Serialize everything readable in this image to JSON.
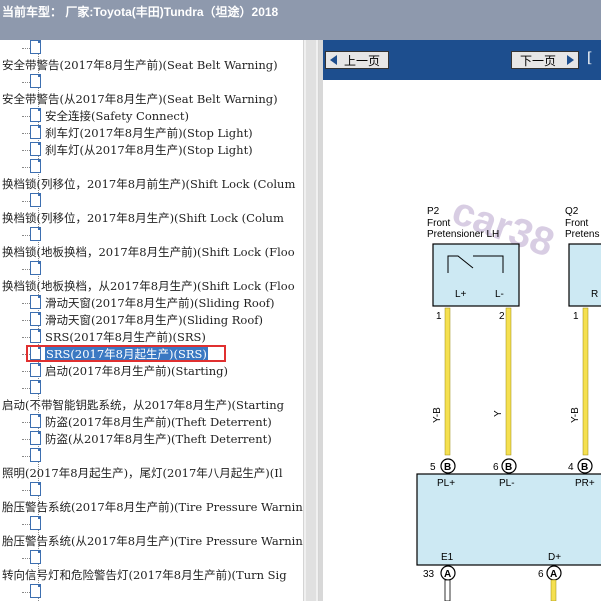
{
  "title": "当前车型： 厂家:Toyota(丰田)Tundra（坦途）2018",
  "tree": {
    "items": [
      {
        "label": "",
        "level": 1
      },
      {
        "label": "安全带警告(2017年8月生产前)(Seat Belt Warning)",
        "level": 0
      },
      {
        "label": "",
        "level": 1
      },
      {
        "label": "安全带警告(从2017年8月生产)(Seat Belt Warning)",
        "level": 0
      },
      {
        "label": "安全连接(Safety Connect)",
        "level": 1
      },
      {
        "label": "刹车灯(2017年8月生产前)(Stop Light)",
        "level": 1
      },
      {
        "label": "刹车灯(从2017年8月生产)(Stop Light)",
        "level": 1
      },
      {
        "label": "",
        "level": 1
      },
      {
        "label": "换档锁(列移位，2017年8月前生产)(Shift Lock (Colum",
        "level": 0
      },
      {
        "label": "",
        "level": 1
      },
      {
        "label": "换档锁(列移位，2017年8月生产)(Shift Lock (Colum",
        "level": 0
      },
      {
        "label": "",
        "level": 1
      },
      {
        "label": "换档锁(地板换档，2017年8月生产前)(Shift Lock (Floo",
        "level": 0
      },
      {
        "label": "",
        "level": 1
      },
      {
        "label": "换档锁(地板换档，从2017年8月生产)(Shift Lock (Floo",
        "level": 0
      },
      {
        "label": "滑动天窗(2017年8月生产前)(Sliding Roof)",
        "level": 1
      },
      {
        "label": "滑动天窗(2017年8月生产)(Sliding Roof)",
        "level": 1
      },
      {
        "label": "SRS(2017年8月生产前)(SRS)",
        "level": 1
      },
      {
        "label": "SRS(2017年8月起生产)(SRS)",
        "level": 1
      },
      {
        "label": "启动(2017年8月生产前)(Starting)",
        "level": 1
      },
      {
        "label": "",
        "level": 1
      },
      {
        "label": "启动(不带智能钥匙系统，从2017年8月生产)(Starting",
        "level": 0
      },
      {
        "label": "防盗(2017年8月生产前)(Theft Deterrent)",
        "level": 1
      },
      {
        "label": "防盗(从2017年8月生产)(Theft Deterrent)",
        "level": 1
      },
      {
        "label": "",
        "level": 1
      },
      {
        "label": "照明(2017年8月起生产)，尾灯(2017年八月起生产)(Il",
        "level": 0
      },
      {
        "label": "",
        "level": 1
      },
      {
        "label": "胎压警告系统(2017年8月生产前)(Tire Pressure Warnin",
        "level": 0
      },
      {
        "label": "",
        "level": 1
      },
      {
        "label": "胎压警告系统(从2017年8月生产)(Tire Pressure Warnin",
        "level": 0
      },
      {
        "label": "",
        "level": 1
      },
      {
        "label": "转向信号灯和危险警告灯(2017年8月生产前)(Turn Sig",
        "level": 0
      },
      {
        "label": "",
        "level": 1
      }
    ],
    "selected_label": "SRS(2017年8月起生产)(SRS)"
  },
  "viewer": {
    "prev_label": "上一页",
    "next_label": "下一页",
    "tail_char": "[",
    "watermark": "car38",
    "diagram": {
      "p2_code": "P2",
      "p2_name_1": "Front",
      "p2_name_2": "Pretensioner LH",
      "q2_code": "Q2",
      "q2_name_1": "Front",
      "q2_name_2": "Pretens",
      "pin_l_plus": "L+",
      "pin_l_minus": "L-",
      "pin_r": "R",
      "pin1": "1",
      "pin2": "2",
      "pin1b": "1",
      "wire1": "Y-B",
      "wire2": "Y",
      "wire3": "Y-B",
      "conn5": "5",
      "conn6": "6",
      "conn4": "4",
      "letter_b": "B",
      "pl_plus": "PL+",
      "pl_minus": "PL-",
      "pr_plus": "PR+",
      "e1": "E1",
      "d_plus": "D+",
      "n33": "33",
      "n6": "6",
      "letter_a": "A"
    }
  }
}
